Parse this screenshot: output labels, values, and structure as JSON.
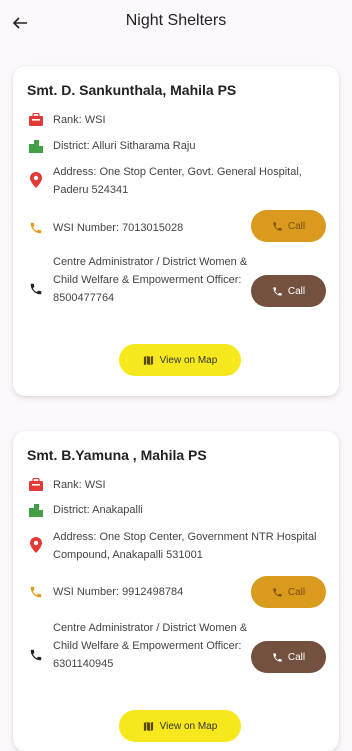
{
  "appbar": {
    "title": "Night Shelters"
  },
  "shelters": [
    {
      "name": "Smt. D. Sankunthala,  Mahila PS",
      "rank": "Rank: WSI",
      "district": "District: Alluri Sitharama Raju",
      "address": "Address: One Stop Center, Govt. General Hospital, Paderu 524341",
      "wsi_number": "WSI Number: 7013015028",
      "admin": "Centre Administrator / District Women & Child Welfare & Empowerment Officer: 8500477764",
      "call_label": "Call",
      "map_label": "View on Map"
    },
    {
      "name": "Smt. B.Yamuna , Mahila PS",
      "rank": "Rank: WSI",
      "district": "District: Anakapalli",
      "address": "Address: One Stop Center, Government NTR Hospital Compound, Anakapalli 531001",
      "wsi_number": "WSI Number: 9912498784",
      "admin": "Centre Administrator / District Women & Child Welfare & Empowerment Officer: 6301140945",
      "call_label": "Call",
      "map_label": "View on Map"
    }
  ],
  "colors": {
    "accent_red": "#e53935",
    "accent_green": "#43a047",
    "phone_orange": "#e69a15",
    "call_wsi": "#d99a1d",
    "call_admin": "#74503f",
    "map_yellow": "#f7e81d"
  }
}
